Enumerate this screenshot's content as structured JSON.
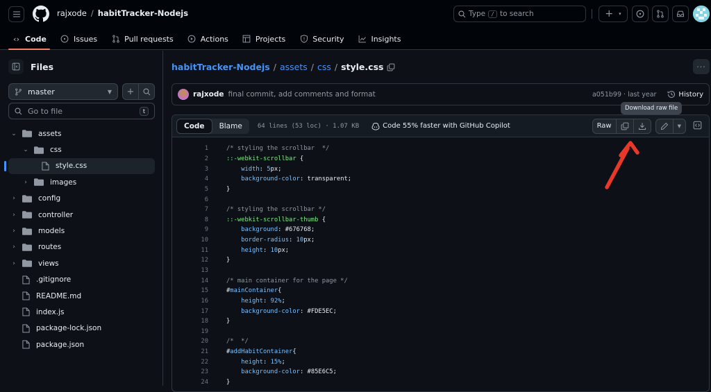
{
  "header": {
    "owner": "rajxode",
    "separator": "/",
    "repo": "habitTracker-Nodejs",
    "search_placeholder_pre": "Type",
    "search_key": "/",
    "search_placeholder_post": "to search"
  },
  "nav_tabs": [
    {
      "label": "Code",
      "icon": "code-icon",
      "active": true
    },
    {
      "label": "Issues",
      "icon": "issue-icon"
    },
    {
      "label": "Pull requests",
      "icon": "pull-request-icon"
    },
    {
      "label": "Actions",
      "icon": "play-icon"
    },
    {
      "label": "Projects",
      "icon": "table-icon"
    },
    {
      "label": "Security",
      "icon": "shield-icon"
    },
    {
      "label": "Insights",
      "icon": "graph-icon"
    }
  ],
  "sidebar": {
    "title": "Files",
    "branch": "master",
    "goto_placeholder": "Go to file",
    "goto_key": "t",
    "tree": [
      {
        "name": "assets",
        "type": "folder",
        "expanded": true,
        "depth": 0
      },
      {
        "name": "css",
        "type": "folder",
        "expanded": true,
        "depth": 1
      },
      {
        "name": "style.css",
        "type": "file",
        "depth": 2,
        "selected": true
      },
      {
        "name": "images",
        "type": "folder",
        "expanded": false,
        "depth": 1
      },
      {
        "name": "config",
        "type": "folder",
        "expanded": false,
        "depth": 0
      },
      {
        "name": "controller",
        "type": "folder",
        "expanded": false,
        "depth": 0
      },
      {
        "name": "models",
        "type": "folder",
        "expanded": false,
        "depth": 0
      },
      {
        "name": "routes",
        "type": "folder",
        "expanded": false,
        "depth": 0
      },
      {
        "name": "views",
        "type": "folder",
        "expanded": false,
        "depth": 0
      },
      {
        "name": ".gitignore",
        "type": "file",
        "depth": 0
      },
      {
        "name": "README.md",
        "type": "file",
        "depth": 0
      },
      {
        "name": "index.js",
        "type": "file",
        "depth": 0
      },
      {
        "name": "package-lock.json",
        "type": "file",
        "depth": 0
      },
      {
        "name": "package.json",
        "type": "file",
        "depth": 0
      }
    ]
  },
  "breadcrumb": {
    "root": "habitTracker-Nodejs",
    "parts": [
      "assets",
      "css"
    ],
    "current": "style.css"
  },
  "commit": {
    "author": "rajxode",
    "message": "final commit, add comments and format",
    "sha_time": "a051b99 · last year",
    "history_label": "History"
  },
  "file": {
    "tab_code": "Code",
    "tab_blame": "Blame",
    "info": "64 lines (53 loc) · 1.07 KB",
    "copilot": "Code 55% faster with GitHub Copilot",
    "raw_label": "Raw",
    "tooltip": "Download raw file"
  },
  "code_lines": [
    [
      {
        "t": "/* styling the scrollbar  */",
        "c": "cm"
      }
    ],
    [
      {
        "t": "::-webkit-scrollbar",
        "c": "sel"
      },
      {
        "t": " {",
        "c": ""
      }
    ],
    [
      {
        "t": "    ",
        "c": ""
      },
      {
        "t": "width",
        "c": "prop"
      },
      {
        "t": ": ",
        "c": ""
      },
      {
        "t": "5",
        "c": "num"
      },
      {
        "t": "px;",
        "c": ""
      }
    ],
    [
      {
        "t": "    ",
        "c": ""
      },
      {
        "t": "background-color",
        "c": "prop"
      },
      {
        "t": ": transparent;",
        "c": ""
      }
    ],
    [
      {
        "t": "}",
        "c": ""
      }
    ],
    [],
    [
      {
        "t": "/* styling the scrollbar */",
        "c": "cm"
      }
    ],
    [
      {
        "t": "::-webkit-scrollbar-thumb",
        "c": "sel"
      },
      {
        "t": " {",
        "c": ""
      }
    ],
    [
      {
        "t": "    ",
        "c": ""
      },
      {
        "t": "background",
        "c": "prop"
      },
      {
        "t": ": #676768;",
        "c": ""
      }
    ],
    [
      {
        "t": "    ",
        "c": ""
      },
      {
        "t": "border-radius",
        "c": "prop"
      },
      {
        "t": ": ",
        "c": ""
      },
      {
        "t": "10",
        "c": "num"
      },
      {
        "t": "px;",
        "c": ""
      }
    ],
    [
      {
        "t": "    ",
        "c": ""
      },
      {
        "t": "height",
        "c": "prop"
      },
      {
        "t": ": ",
        "c": ""
      },
      {
        "t": "10",
        "c": "num"
      },
      {
        "t": "px;",
        "c": ""
      }
    ],
    [
      {
        "t": "}",
        "c": ""
      }
    ],
    [],
    [
      {
        "t": "/* main container for the page */",
        "c": "cm"
      }
    ],
    [
      {
        "t": "#",
        "c": ""
      },
      {
        "t": "mainContainer",
        "c": "prop"
      },
      {
        "t": "{",
        "c": ""
      }
    ],
    [
      {
        "t": "    ",
        "c": ""
      },
      {
        "t": "height",
        "c": "prop"
      },
      {
        "t": ": ",
        "c": ""
      },
      {
        "t": "92%",
        "c": "num"
      },
      {
        "t": ";",
        "c": ""
      }
    ],
    [
      {
        "t": "    ",
        "c": ""
      },
      {
        "t": "background-color",
        "c": "prop"
      },
      {
        "t": ": #FDE5EC;",
        "c": ""
      }
    ],
    [
      {
        "t": "}",
        "c": ""
      }
    ],
    [],
    [
      {
        "t": "/*  */",
        "c": "cm"
      }
    ],
    [
      {
        "t": "#",
        "c": ""
      },
      {
        "t": "addHabitContainer",
        "c": "prop"
      },
      {
        "t": "{",
        "c": ""
      }
    ],
    [
      {
        "t": "    ",
        "c": ""
      },
      {
        "t": "height",
        "c": "prop"
      },
      {
        "t": ": ",
        "c": ""
      },
      {
        "t": "15%",
        "c": "num"
      },
      {
        "t": ";",
        "c": ""
      }
    ],
    [
      {
        "t": "    ",
        "c": ""
      },
      {
        "t": "background-color",
        "c": "prop"
      },
      {
        "t": ": #85E6C5;",
        "c": ""
      }
    ],
    [
      {
        "t": "}",
        "c": ""
      }
    ]
  ],
  "colors": {
    "accent": "#4493f8",
    "tab_underline": "#f78166",
    "annotation_arrow": "#e8382a"
  }
}
